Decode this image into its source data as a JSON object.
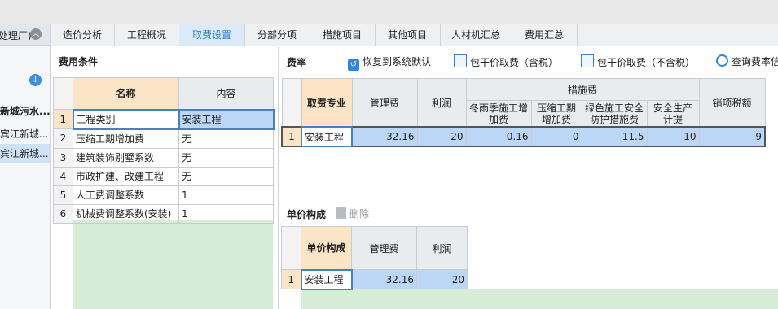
{
  "sidebar": {
    "header": "处理厂)",
    "items": [
      "新城污水...",
      "宾江新城...",
      "宾江新城..."
    ]
  },
  "tabs": [
    "造价分析",
    "工程概况",
    "取费设置",
    "分部分项",
    "措施项目",
    "其他项目",
    "人材机汇总",
    "费用汇总"
  ],
  "active_tab": "取费设置",
  "conditions": {
    "title": "费用条件",
    "col_name": "名称",
    "col_content": "内容",
    "rows": [
      {
        "no": "1",
        "name": "工程类别",
        "value": "安装工程"
      },
      {
        "no": "2",
        "name": "压缩工期增加费",
        "value": "无"
      },
      {
        "no": "3",
        "name": "建筑装饰别墅系数",
        "value": "无"
      },
      {
        "no": "4",
        "name": "市政扩建、改建工程",
        "value": "无"
      },
      {
        "no": "5",
        "name": "人工费调整系数",
        "value": "1"
      },
      {
        "no": "6",
        "name": "机械费调整系数(安装)",
        "value": "1"
      }
    ]
  },
  "rates": {
    "title": "费率",
    "btn_restore": "恢复到系统默认",
    "btn_incl_tax": "包干价取费（含税）",
    "btn_excl_tax": "包干价取费（不含税）",
    "btn_query": "查询费率信",
    "headers": {
      "specialty": "取费专业",
      "mgmt": "管理费",
      "profit": "利润",
      "measures": "措施费",
      "winter": "冬雨季施工增加费",
      "compress": "压缩工期增加费",
      "green": "绿色施工安全防护措施费",
      "safety": "安全生产计提",
      "tax": "销项税额"
    },
    "row": {
      "no": "1",
      "specialty": "安装工程",
      "mgmt": "32.16",
      "profit": "20",
      "winter": "0.16",
      "compress": "0",
      "green": "11.5",
      "safety": "10",
      "tax": "9"
    }
  },
  "unit_price": {
    "title": "单价构成",
    "btn_delete": "删除",
    "headers": {
      "composition": "单价构成",
      "mgmt": "管理费",
      "profit": "利润"
    },
    "row": {
      "no": "1",
      "composition": "安装工程",
      "mgmt": "32.16",
      "profit": "20"
    }
  }
}
